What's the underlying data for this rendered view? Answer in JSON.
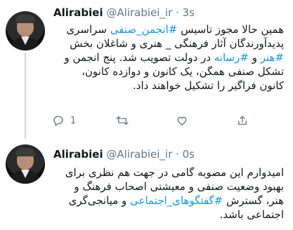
{
  "tweets": [
    {
      "name": "Alirabiei",
      "handle": "@Alirabiei_ir",
      "separator": "·",
      "time": "3s",
      "lines": [
        [
          {
            "text": "همین حالا مجوز تاسیس "
          },
          {
            "text": "#انجمن_صنفی",
            "hashtag": true
          },
          {
            "text": " سراسری"
          }
        ],
        [
          {
            "text": "پدیدآورندگان آثار فرهنگی _ هنری و شاغلان بخش"
          }
        ],
        [
          {
            "text": "#هنر",
            "hashtag": true
          },
          {
            "text": " و "
          },
          {
            "text": "#رسانه",
            "hashtag": true
          },
          {
            "text": " در دولت تصویب شد. پنج انجمن و"
          }
        ],
        [
          {
            "text": "تشکل صنفی همگن، یک کانون و دوازده کانون،"
          }
        ],
        [
          {
            "text": "کانون فراگیر را تشکیل خواهند داد."
          }
        ]
      ],
      "actions": {
        "reply_count": "1"
      }
    },
    {
      "name": "Alirabiei",
      "handle": "@Alirabiei_ir",
      "separator": "·",
      "time": "0s",
      "lines": [
        [
          {
            "text": "امیدوارم این مصوبه گامی در جهت هم نظری برای"
          }
        ],
        [
          {
            "text": "بهبود وضعیت صنفی و معیشتی اصحاب فرهنگ و"
          }
        ],
        [
          {
            "text": "هنر، گسترش "
          },
          {
            "text": "#گفتگوهای_اجتماعی",
            "hashtag": true
          },
          {
            "text": " و میانجی‌گری"
          }
        ],
        [
          {
            "text": "اجتماعی باشد."
          }
        ]
      ]
    }
  ],
  "icons": {
    "reply": "reply-icon",
    "retweet": "retweet-icon",
    "like": "heart-icon",
    "share": "share-icon"
  },
  "colors": {
    "hashtag": "#1b95e0",
    "muted": "#657786",
    "text": "#14171a",
    "thread_line": "#ccd6dd"
  }
}
